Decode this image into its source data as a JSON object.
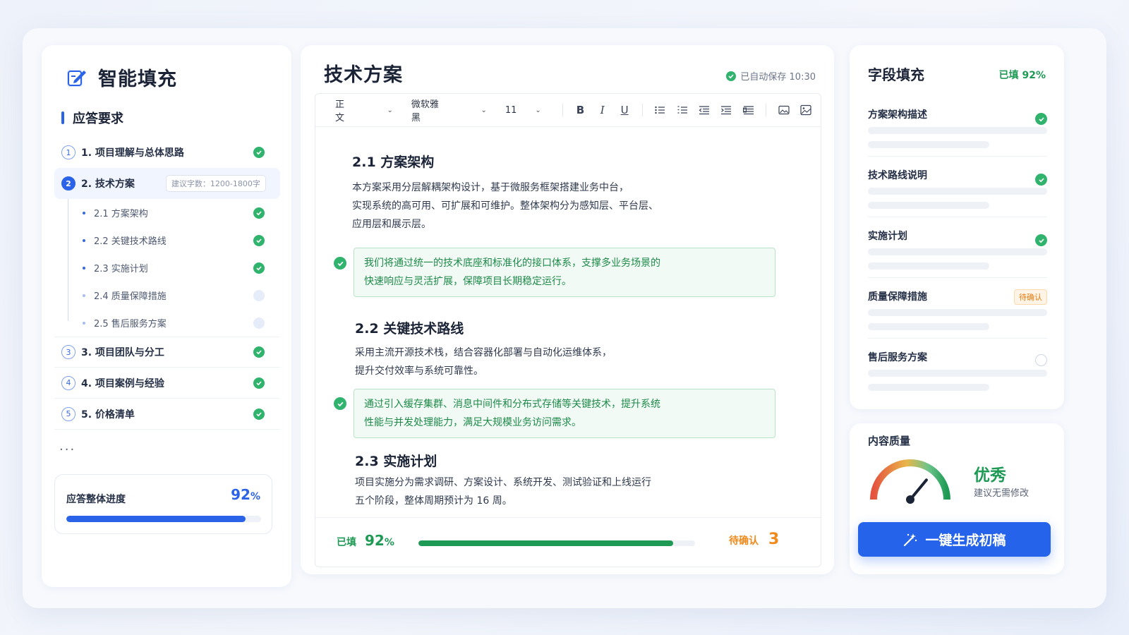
{
  "app": {
    "title": "智能填充"
  },
  "sidebar": {
    "section_title": "应答要求",
    "items": [
      {
        "num": "1",
        "label": "1. 项目理解与总体思路",
        "status": "done"
      },
      {
        "num": "2",
        "label": "2. 技术方案",
        "badge": "建议字数：1200-1800字",
        "active": true
      },
      {
        "num": "3",
        "label": "3. 项目团队与分工",
        "status": "done"
      },
      {
        "num": "4",
        "label": "4. 项目案例与经验",
        "status": "done"
      },
      {
        "num": "5",
        "label": "5. 价格清单",
        "status": "done"
      }
    ],
    "subitems": [
      {
        "label": "2.1  方案架构",
        "status": "done"
      },
      {
        "label": "2.2  关键技术路线",
        "status": "done"
      },
      {
        "label": "2.3  实施计划",
        "status": "done"
      },
      {
        "label": "2.4  质量保障措施",
        "status": "pending"
      },
      {
        "label": "2.5  售后服务方案",
        "status": "pending"
      }
    ],
    "more": "...",
    "progress": {
      "label": "应答整体进度",
      "value": "92",
      "unit": "%",
      "fraction": 0.92
    }
  },
  "document": {
    "title": "技术方案",
    "autosave": "已自动保存 10:30",
    "toolbar": {
      "style": "正文",
      "font": "微软雅黑",
      "size": "11"
    },
    "sections": [
      {
        "heading": "2.1 方案架构",
        "lines": [
          "本方案采用分层解耦架构设计，基于微服务框架搭建业务中台，",
          "实现系统的高可用、可扩展和可维护。整体架构分为感知层、平台层、",
          "应用层和展示层。"
        ],
        "highlight": [
          "我们将通过统一的技术底座和标准化的接口体系，支撑多业务场景的",
          "快速响应与灵活扩展，保障项目长期稳定运行。"
        ]
      },
      {
        "heading": "2.2 关键技术路线",
        "lines": [
          "采用主流开源技术栈，结合容器化部署与自动化运维体系，",
          "提升交付效率与系统可靠性。"
        ],
        "highlight": [
          "通过引入缓存集群、消息中间件和分布式存储等关键技术，提升系统",
          "性能与并发处理能力，满足大规模业务访问需求。"
        ]
      },
      {
        "heading": "2.3 实施计划",
        "lines": [
          "项目实施分为需求调研、方案设计、系统开发、测试验证和上线运行",
          "五个阶段，整体周期预计为 16 周。"
        ]
      }
    ],
    "footer": {
      "filled_label": "已填",
      "filled_value": "92",
      "filled_unit": "%",
      "filled_fraction": 0.92,
      "pending_label": "待确认",
      "pending_value": "3"
    }
  },
  "fields_panel": {
    "title": "字段填充",
    "rate": "已填  92%",
    "fields": [
      {
        "name": "方案架构描述",
        "status": "done"
      },
      {
        "name": "技术路线说明",
        "status": "done"
      },
      {
        "name": "实施计划",
        "status": "done"
      },
      {
        "name": "质量保障措施",
        "status": "pending",
        "tag": "待确认"
      },
      {
        "name": "售后服务方案",
        "status": "empty"
      }
    ]
  },
  "quality": {
    "title": "内容质量",
    "grade": "优秀",
    "note": "建议无需修改",
    "gauge_fraction": 0.72,
    "colors": {
      "good": "#1e9a55",
      "mid": "#e8b64a",
      "bad": "#e5533f"
    }
  },
  "generate_button": {
    "label": "一键生成初稿"
  }
}
